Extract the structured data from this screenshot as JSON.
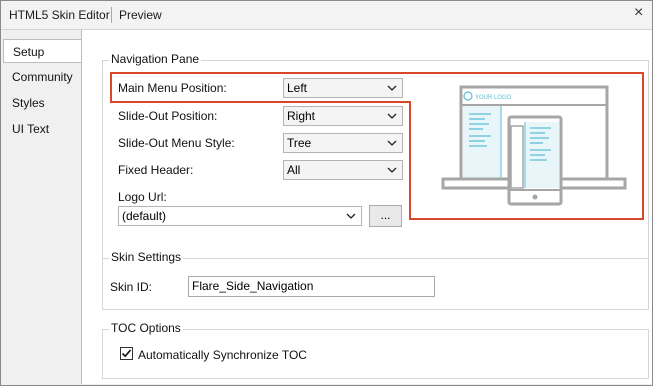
{
  "window": {
    "tabs": [
      {
        "label": "HTML5 Skin Editor"
      },
      {
        "label": "Preview"
      }
    ],
    "close_glyph": "×"
  },
  "sidebar": {
    "items": [
      {
        "label": "Setup",
        "active": true
      },
      {
        "label": "Community"
      },
      {
        "label": "Styles"
      },
      {
        "label": "UI Text"
      }
    ]
  },
  "navigation_pane": {
    "title": "Navigation Pane",
    "main_menu_position": {
      "label": "Main Menu Position:",
      "value": "Left"
    },
    "slide_out_position": {
      "label": "Slide-Out Position:",
      "value": "Right"
    },
    "slide_out_menu_style": {
      "label": "Slide-Out Menu Style:",
      "value": "Tree"
    },
    "fixed_header": {
      "label": "Fixed Header:",
      "value": "All"
    },
    "logo_url": {
      "label": "Logo Url:",
      "value": "(default)",
      "browse_label": "..."
    },
    "preview": {
      "logo_text": "YOUR LOGO"
    },
    "highlight_color": "#d9472b",
    "preview_accent": "#5bbfd6"
  },
  "skin_settings": {
    "title": "Skin Settings",
    "skin_id": {
      "label": "Skin ID:",
      "value": "Flare_Side_Navigation"
    }
  },
  "toc_options": {
    "title": "TOC Options",
    "auto_sync": {
      "label": "Automatically Synchronize TOC",
      "checked": true
    }
  }
}
